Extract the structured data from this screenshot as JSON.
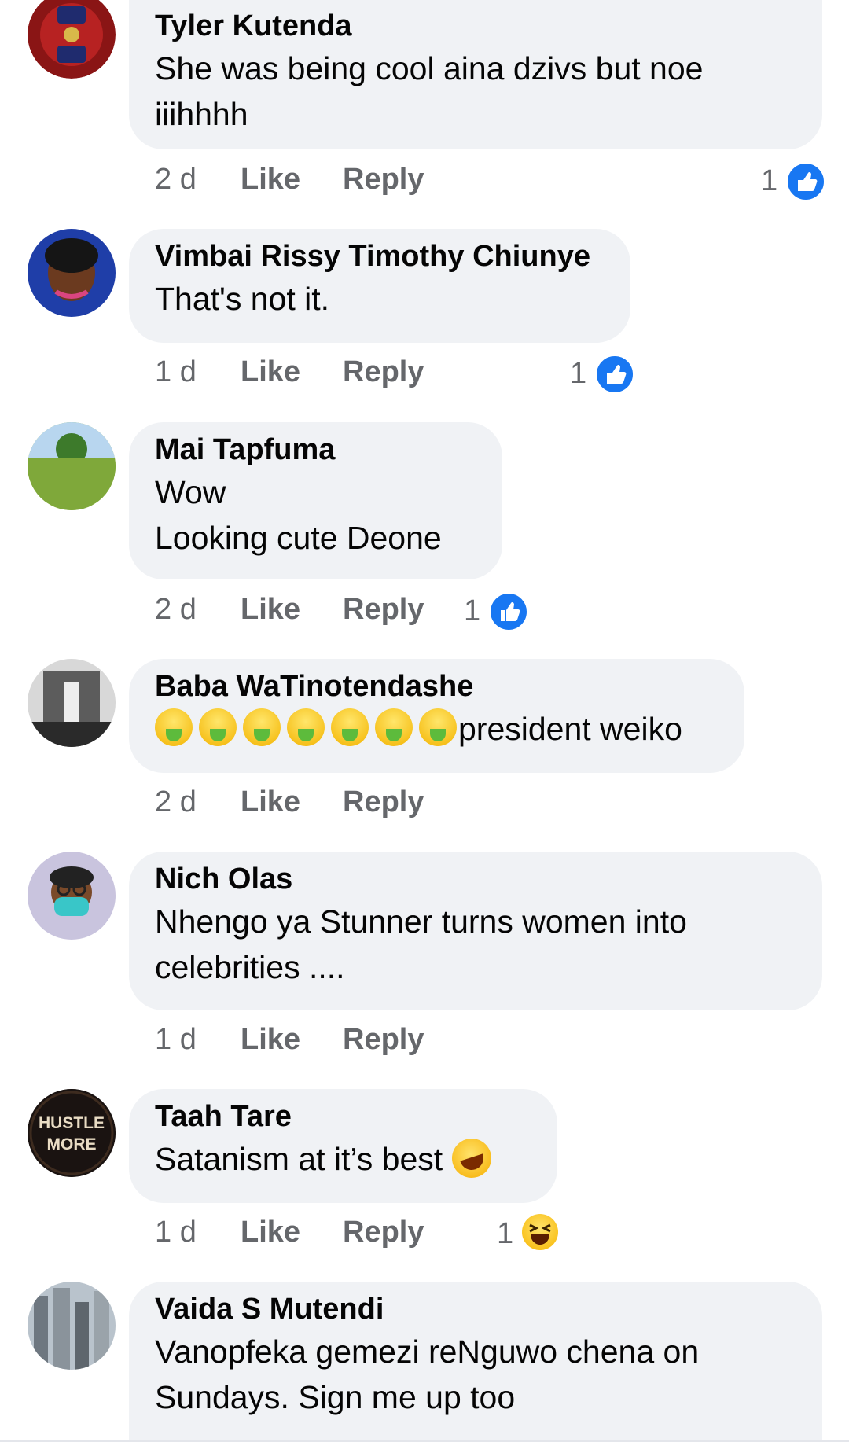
{
  "comments": [
    {
      "name": "Tyler Kutenda",
      "lines": [
        "She was being cool aina dzivs but noe",
        "iiihhhh"
      ],
      "time": "2 d",
      "like": "Like",
      "reply": "Reply",
      "reaction_count": "1",
      "reaction": "like-icon"
    },
    {
      "name": "Vimbai Rissy Timothy Chiunye",
      "lines": [
        "That's not it."
      ],
      "time": "1 d",
      "like": "Like",
      "reply": "Reply",
      "reaction_count": "1",
      "reaction": "like-icon"
    },
    {
      "name": "Mai Tapfuma",
      "lines": [
        "Wow",
        "Looking cute Deone"
      ],
      "time": "2 d",
      "like": "Like",
      "reply": "Reply",
      "reaction_count": "1",
      "reaction": "like-icon"
    },
    {
      "name": "Baba WaTinotendashe",
      "lines": [
        "president weiko"
      ],
      "time": "2 d",
      "like": "Like",
      "reply": "Reply"
    },
    {
      "name": "Nich Olas",
      "lines": [
        "Nhengo ya Stunner turns women into",
        "celebrities ...."
      ],
      "time": "1 d",
      "like": "Like",
      "reply": "Reply"
    },
    {
      "name": "Taah Tare",
      "lines": [
        "Satanism at it’s best"
      ],
      "time": "1 d",
      "like": "Like",
      "reply": "Reply",
      "reaction_count": "1",
      "reaction": "haha-icon"
    },
    {
      "name": "Vaida S Mutendi",
      "lines": [
        "Vanopfeka gemezi reNguwo chena on",
        "Sundays. Sign me up too"
      ]
    }
  ],
  "avatar4_text": [
    "HUSTLE",
    "MORE"
  ],
  "colors": {
    "bubble": "#f0f2f5",
    "meta": "#65676b",
    "like_blue": "#1877f2"
  }
}
